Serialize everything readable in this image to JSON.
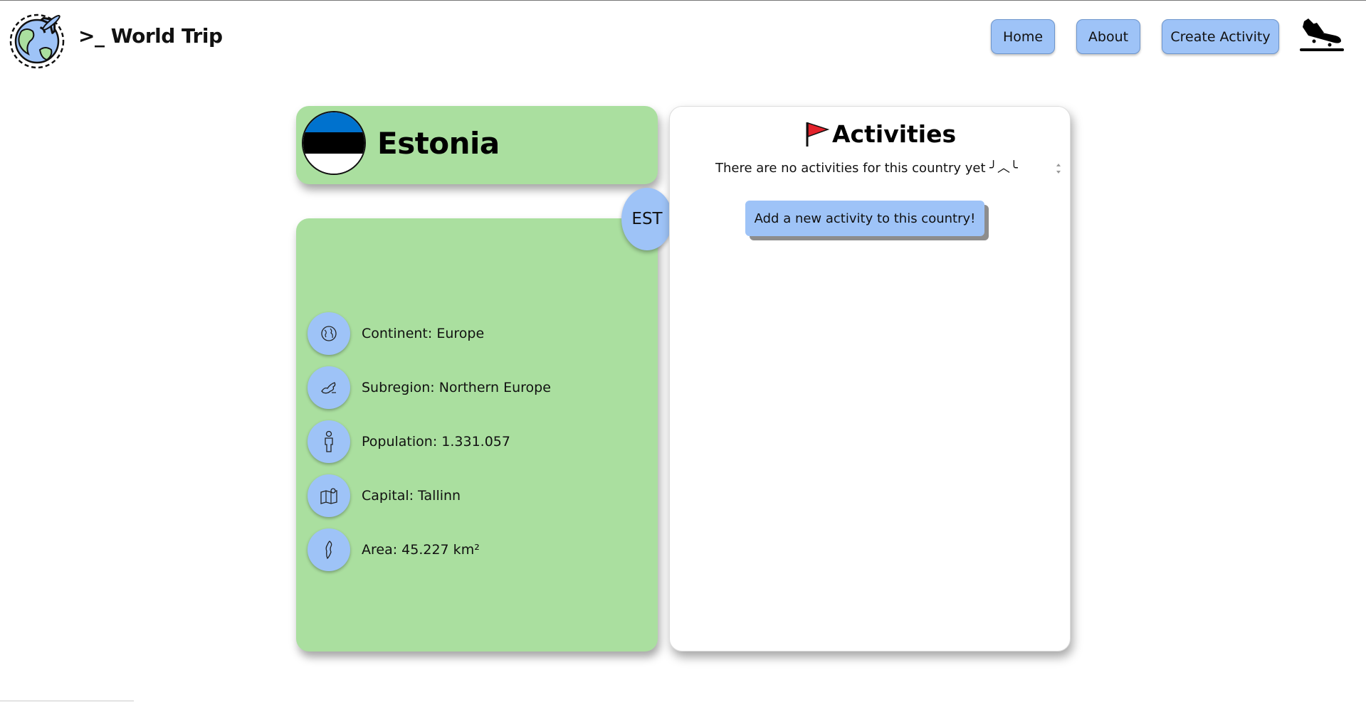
{
  "header": {
    "brand": ">_ World Trip",
    "nav": {
      "home": "Home",
      "about": "About",
      "create_activity": "Create Activity"
    }
  },
  "country": {
    "name": "Estonia",
    "code": "EST",
    "flag_colors": [
      "#0072ce",
      "#000000",
      "#ffffff"
    ],
    "info": {
      "continent": "Continent: Europe",
      "subregion": "Subregion: Northern Europe",
      "population": "Population: 1.331.057",
      "capital": "Capital: Tallinn",
      "area": "Area: 45.227 km²"
    }
  },
  "activities": {
    "title": "Activities",
    "empty_message": "There are no activities for this country yet ╯︿╰",
    "add_button": "Add a new activity to this country!"
  },
  "colors": {
    "green_card": "#aadf9f",
    "blue_button": "#9ec3f7",
    "flag_red": "#e3222b"
  }
}
